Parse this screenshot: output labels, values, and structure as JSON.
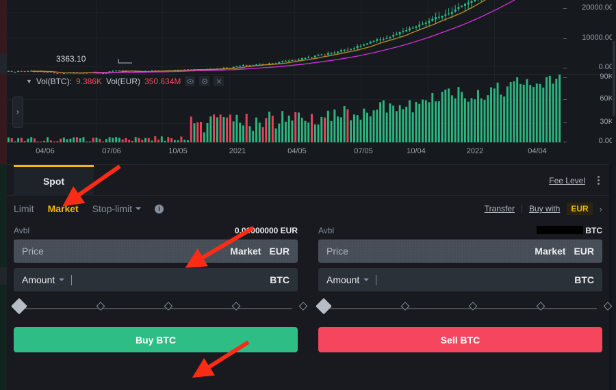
{
  "chart": {
    "price_low_label": "3363.10",
    "price_axis_labels": [
      "20000.00",
      "10000.00",
      "0.00"
    ],
    "volume_axis_labels": [
      "90K",
      "60K",
      "30K",
      "0.00"
    ],
    "x_axis_labels": [
      "04/06",
      "07/06",
      "10/05",
      "2021",
      "04/05",
      "07/05",
      "10/04",
      "2022",
      "04/04"
    ],
    "indicator": {
      "caret": "▼",
      "btc_label": "Vol(BTC):",
      "btc_value": "9.386K",
      "eur_label": "Vol(EUR)",
      "eur_value": "350.634M",
      "eye_icon": "◉",
      "gear_icon": "⚙",
      "close_icon": "✕"
    },
    "collapse_icon": "›",
    "colors": {
      "up": "#2ebd85",
      "down": "#f6465d",
      "ma_short": "#b58a2b",
      "ma_long": "#c930d1"
    }
  },
  "chart_data": {
    "type": "line",
    "title": "",
    "xlabel": "",
    "ylabel": "",
    "price_axis": {
      "ticks": [
        0,
        10000,
        20000
      ],
      "tick_labels": [
        "0.00",
        "10000.00",
        "20000.00"
      ]
    },
    "volume_axis": {
      "ticks": [
        0,
        30000,
        60000,
        90000
      ],
      "tick_labels": [
        "0.00",
        "30K",
        "60K",
        "90K"
      ]
    },
    "annotations": [
      {
        "text": "3363.10",
        "type": "low-marker"
      }
    ],
    "legend": [
      "Vol(BTC): 9.386K",
      "Vol(EUR) 350.634M"
    ]
  },
  "panel": {
    "spot_tab": "Spot",
    "fee_level": "Fee Level",
    "kebab_icon": "more-vertical",
    "order_types": [
      {
        "label": "Limit",
        "active": false,
        "has_caret": false
      },
      {
        "label": "Market",
        "active": true,
        "has_caret": false
      },
      {
        "label": "Stop-limit",
        "active": false,
        "has_caret": true
      }
    ],
    "info_icon": "i",
    "transfer": "Transfer",
    "buy_with": "Buy with",
    "buy_with_currency": "EUR",
    "chevron_right": "›"
  },
  "buy_form": {
    "avbl_label": "Avbl",
    "avbl_value": "0.00000000 EUR",
    "price_placeholder": "Price",
    "price_mode": "Market",
    "price_unit": "EUR",
    "amount_placeholder": "Amount",
    "amount_unit": "BTC",
    "button": "Buy BTC",
    "button_color": "#2ebd85"
  },
  "sell_form": {
    "avbl_label": "Avbl",
    "avbl_value": "",
    "avbl_unit": "BTC",
    "avbl_redacted": true,
    "price_placeholder": "Price",
    "price_mode": "Market",
    "price_unit": "EUR",
    "amount_placeholder": "Amount",
    "amount_unit": "BTC",
    "button": "Sell BTC",
    "button_color": "#f6465d"
  },
  "slider": {
    "positions": [
      0,
      25,
      50,
      75,
      100
    ],
    "value": 0
  },
  "annotations": {
    "arrow_color": "#fb2c16",
    "count": 3
  }
}
